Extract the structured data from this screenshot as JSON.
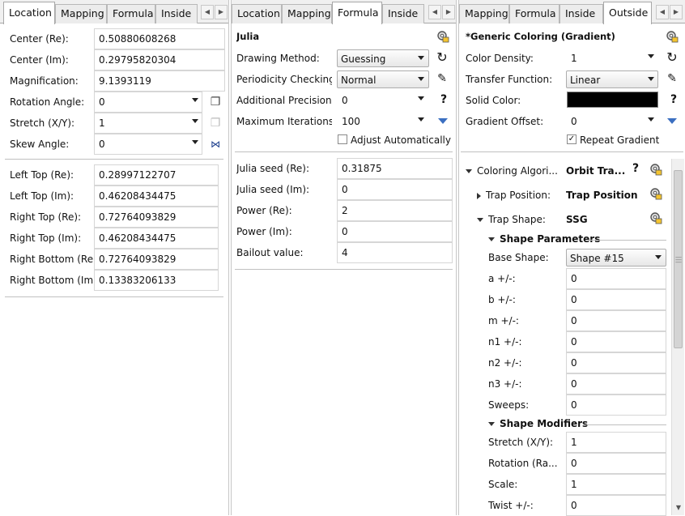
{
  "panel1": {
    "tabs": [
      "Location",
      "Mapping",
      "Formula",
      "Inside"
    ],
    "fields": [
      {
        "label": "Center (Re):",
        "value": "0.50880608268"
      },
      {
        "label": "Center (Im):",
        "value": "0.29795820304"
      },
      {
        "label": "Magnification:",
        "value": "9.1393119"
      }
    ],
    "dropdowns": [
      {
        "label": "Rotation Angle:",
        "value": "0",
        "icon": "copy-icon"
      },
      {
        "label": "Stretch (X/Y):",
        "value": "1",
        "icon": "paste-icon"
      },
      {
        "label": "Skew Angle:",
        "value": "0",
        "icon": "flip-icon"
      }
    ],
    "corners": [
      {
        "label": "Left Top (Re):",
        "value": "0.28997122707"
      },
      {
        "label": "Left Top (Im):",
        "value": "0.46208434475"
      },
      {
        "label": "Right Top (Re):",
        "value": "0.72764093829"
      },
      {
        "label": "Right Top (Im):",
        "value": "0.46208434475"
      },
      {
        "label": "Right Bottom (Re)",
        "value": "0.72764093829"
      },
      {
        "label": "Right Bottom (Im)",
        "value": "0.13383206133"
      }
    ]
  },
  "panel2": {
    "tabs": [
      "Location",
      "Mapping",
      "Formula",
      "Inside"
    ],
    "title": "Julia",
    "drawing_method": {
      "label": "Drawing Method:",
      "value": "Guessing"
    },
    "periodicity": {
      "label": "Periodicity Checking",
      "value": "Normal"
    },
    "precision": {
      "label": "Additional Precision",
      "value": "0",
      "help": "?"
    },
    "iterations": {
      "label": "Maximum Iterations",
      "value": "100"
    },
    "adjust": {
      "label": "Adjust Automatically",
      "checked": false
    },
    "params": [
      {
        "label": "Julia seed (Re):",
        "value": "0.31875"
      },
      {
        "label": "Julia seed (Im):",
        "value": "0"
      },
      {
        "label": "Power (Re):",
        "value": "2"
      },
      {
        "label": "Power (Im):",
        "value": "0"
      },
      {
        "label": "Bailout value:",
        "value": "4"
      }
    ]
  },
  "panel3": {
    "tabs": [
      "Mapping",
      "Formula",
      "Inside",
      "Outside"
    ],
    "title": "*Generic Coloring (Gradient)",
    "color_density": {
      "label": "Color Density:",
      "value": "1"
    },
    "transfer": {
      "label": "Transfer Function:",
      "value": "Linear"
    },
    "solid": {
      "label": "Solid Color:",
      "help": "?",
      "color": "#000000"
    },
    "gradient_offset": {
      "label": "Gradient Offset:",
      "value": "0"
    },
    "repeat": {
      "label": "Repeat Gradient",
      "checked": true
    },
    "coloring_algo": {
      "label": "Coloring Algori...",
      "value": "Orbit Tra...",
      "help": "?"
    },
    "trap_position": {
      "label": "Trap Position:",
      "value": "Trap Position"
    },
    "trap_shape": {
      "label": "Trap Shape:",
      "value": "SSG"
    },
    "shape_params_header": "Shape Parameters",
    "base_shape": {
      "label": "Base Shape:",
      "value": "Shape #15"
    },
    "shape_params": [
      {
        "label": "a +/-:",
        "value": "0"
      },
      {
        "label": "b +/-:",
        "value": "0"
      },
      {
        "label": "m +/-:",
        "value": "0"
      },
      {
        "label": "n1 +/-:",
        "value": "0"
      },
      {
        "label": "n2 +/-:",
        "value": "0"
      },
      {
        "label": "n3 +/-:",
        "value": "0"
      },
      {
        "label": "Sweeps:",
        "value": "0"
      }
    ],
    "shape_modifiers_header": "Shape Modifiers",
    "shape_modifiers": [
      {
        "label": "Stretch (X/Y):",
        "value": "1"
      },
      {
        "label": "Rotation (Ra...",
        "value": "0"
      },
      {
        "label": "Scale:",
        "value": "1"
      },
      {
        "label": "Twist +/-:",
        "value": "0"
      }
    ]
  },
  "colors": {
    "accent_blue": "#3b6fc1",
    "field_border": "#d6d6d6"
  }
}
